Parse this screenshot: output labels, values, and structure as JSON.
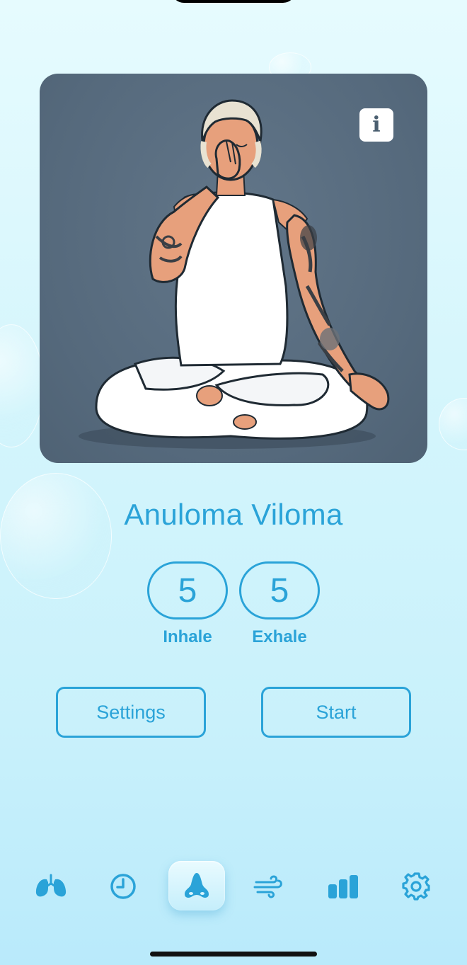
{
  "exercise": {
    "title": "Anuloma Viloma",
    "inhale": {
      "value": "5",
      "label": "Inhale"
    },
    "exhale": {
      "value": "5",
      "label": "Exhale"
    }
  },
  "buttons": {
    "settings_label": "Settings",
    "start_label": "Start"
  },
  "info_icon_glyph": "i",
  "tabbar": {
    "items": [
      {
        "icon": "lungs-icon",
        "active": false
      },
      {
        "icon": "clock-icon",
        "active": false
      },
      {
        "icon": "nose-icon",
        "active": true
      },
      {
        "icon": "wind-icon",
        "active": false
      },
      {
        "icon": "bar-chart-icon",
        "active": false
      },
      {
        "icon": "gear-icon",
        "active": false
      }
    ]
  },
  "colors": {
    "accent": "#2aa3d8",
    "card_bg": "#55697c",
    "background": "#d3f5fc"
  }
}
